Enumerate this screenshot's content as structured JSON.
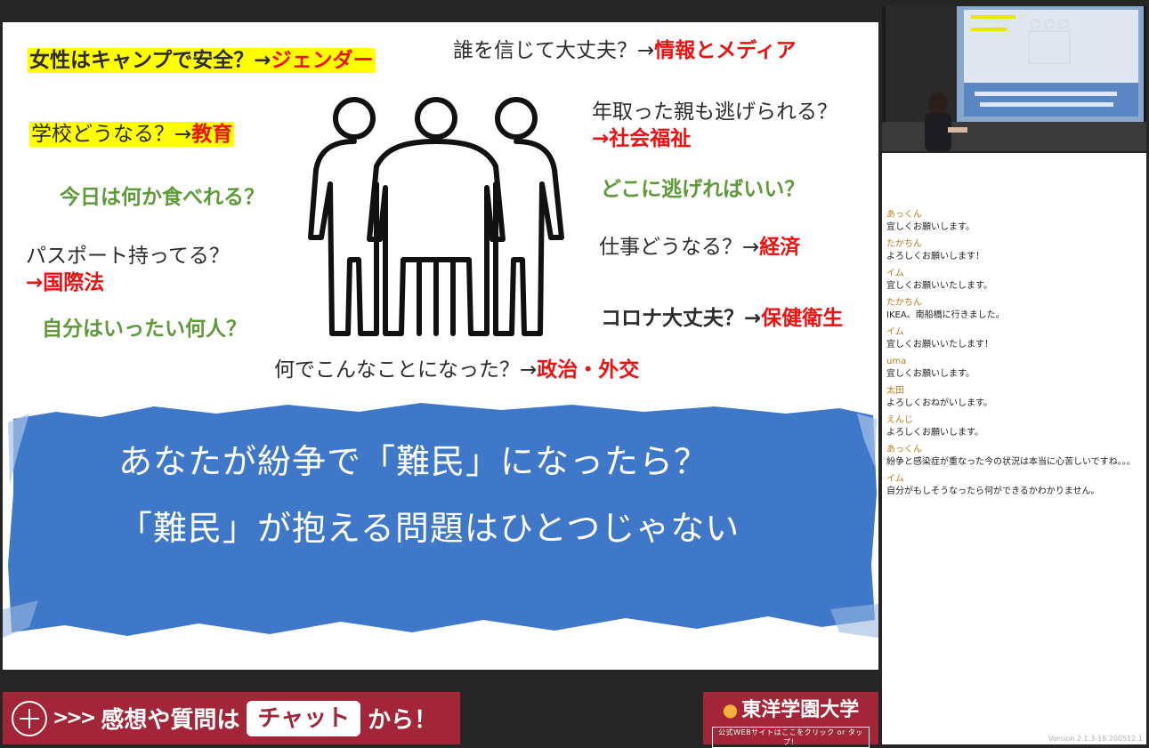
{
  "slide": {
    "questions": [
      {
        "text": "女性はキャンプで安全？→",
        "tag": "ジェンダー"
      },
      {
        "text": "誰を信じて大丈夫？→",
        "tag": "情報とメディア"
      },
      {
        "text": "学校どうなる？→",
        "tag": "教育"
      },
      {
        "text": "年取った親も逃げられる？",
        "tag": "→社会福祉"
      },
      {
        "text": "今日は何か食べれる？"
      },
      {
        "text": "どこに逃げればいい？"
      },
      {
        "text": "パスポート持ってる？",
        "tag": "→国際法"
      },
      {
        "text": "仕事どうなる？→",
        "tag": "経済"
      },
      {
        "text": "自分はいったい何人？"
      },
      {
        "text": "コロナ大丈夫？→",
        "tag": "保健衛生"
      },
      {
        "text": "何でこんなことになった？→",
        "tag": "政治・外交"
      }
    ],
    "banner_line1": "あなたが紛争で「難民」になったら？",
    "banner_line2": "「難民」が抱える問題はひとつじゃない"
  },
  "cta": {
    "arrows": ">>>",
    "text_before": "感想や質問は",
    "chat_label": "チャット",
    "text_after": "から！"
  },
  "logo": {
    "name": "東洋学園大学",
    "sub": "公式WEBサイトはここをクリック or タップ！"
  },
  "chat": {
    "messages": [
      {
        "user": "あっくん",
        "text": "宜しくお願いします。"
      },
      {
        "user": "たかちん",
        "text": "よろしくお願いします！"
      },
      {
        "user": "イム",
        "text": "宜しくお願いいたします。"
      },
      {
        "user": "たかちん",
        "text": "IKEA、南船橋に行きました。"
      },
      {
        "user": "イム",
        "text": "宜しくお願いいたします！"
      },
      {
        "user": "uma",
        "text": "宜しくお願いします。"
      },
      {
        "user": "太田",
        "text": "よろしくおねがいします。"
      },
      {
        "user": "えんじ",
        "text": "よろしくお願いします。"
      },
      {
        "user": "あっくん",
        "text": "紛争と感染症が重なった今の状況は本当に心苦しいですね。。。"
      },
      {
        "user": "イム",
        "text": "自分がもしそうなったら何ができるかわかりません。"
      }
    ]
  },
  "version": "Version 2.1.3-18.200512.1",
  "colors": {
    "accent": "#a32638",
    "banner_blue": "#3f78c8",
    "highlight": "#ffff00",
    "tag_red": "#ee1111",
    "green_question": "#5f9a3a",
    "username": "#b87a1c"
  },
  "icons": [
    "people-icon",
    "plus-circle-icon",
    "flame-icon"
  ]
}
